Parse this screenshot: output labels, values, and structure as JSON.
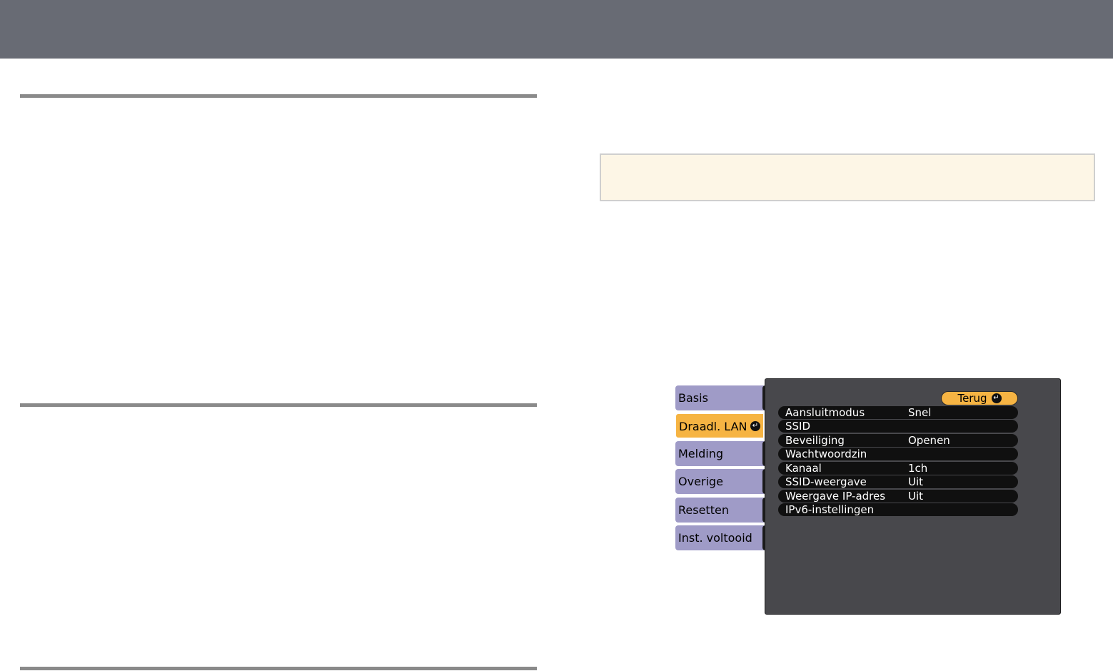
{
  "menu": {
    "tabs": [
      {
        "label": "Basis",
        "active": false
      },
      {
        "label": "Draadl. LAN",
        "active": true
      },
      {
        "label": "Melding",
        "active": false
      },
      {
        "label": "Overige",
        "active": false
      },
      {
        "label": "Resetten",
        "active": false
      },
      {
        "label": "Inst. voltooid",
        "active": false
      }
    ],
    "enter_glyph": "↵",
    "back_label": "Terug",
    "settings": [
      {
        "label": "Aansluitmodus",
        "value": "Snel"
      },
      {
        "label": "SSID",
        "value": ""
      },
      {
        "label": "Beveiliging",
        "value": "Openen"
      },
      {
        "label": "Wachtwoordzin",
        "value": ""
      },
      {
        "label": "Kanaal",
        "value": "1ch"
      },
      {
        "label": "SSID-weergave",
        "value": "Uit"
      },
      {
        "label": "Weergave IP-adres",
        "value": "Uit"
      },
      {
        "label": "IPv6-instellingen",
        "value": ""
      }
    ]
  },
  "colors": {
    "banner": "#686b74",
    "tab_idle": "#9f9bc7",
    "tab_active": "#f6b443",
    "panel": "#48484c",
    "note_bg": "#fdf6e6"
  }
}
